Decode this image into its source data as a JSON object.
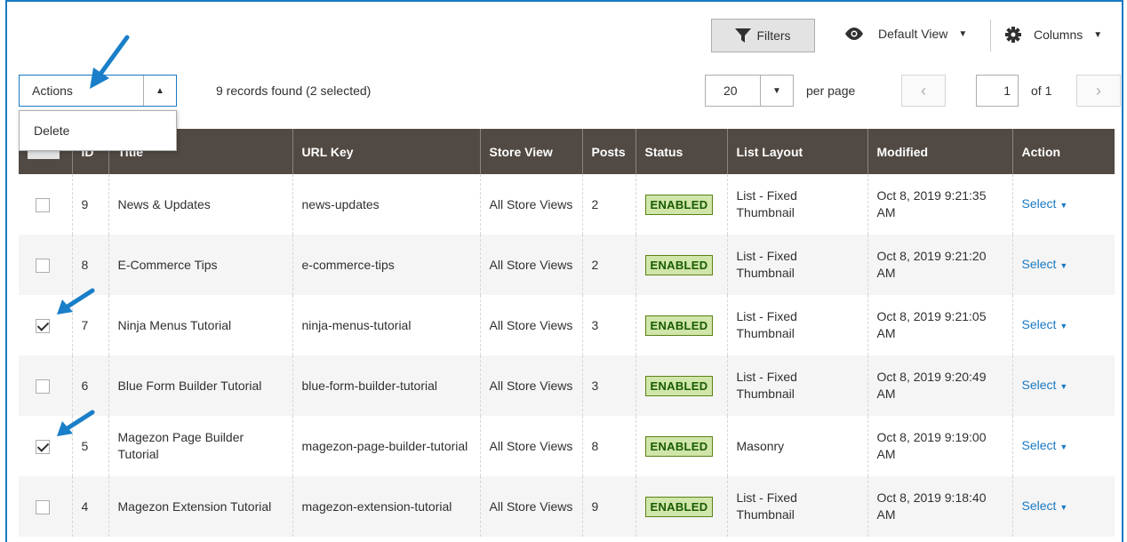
{
  "toolbar": {
    "filters_label": "Filters",
    "view_label": "Default View",
    "columns_label": "Columns"
  },
  "actions": {
    "label": "Actions",
    "menu": [
      "Delete"
    ]
  },
  "records_text": "9 records found (2 selected)",
  "pagination": {
    "per_page_value": "20",
    "per_page_label": "per page",
    "current_page": "1",
    "of_label": "of 1",
    "prev_icon": "chevron-left-icon",
    "next_icon": "chevron-right-icon"
  },
  "table": {
    "headers": [
      "",
      "ID",
      "Title",
      "URL Key",
      "Store View",
      "Posts",
      "Status",
      "List Layout",
      "Modified",
      "Action"
    ],
    "rows": [
      {
        "checked": false,
        "id": "9",
        "title": "News & Updates",
        "url_key": "news-updates",
        "store_view": "All Store Views",
        "posts": "2",
        "status": "ENABLED",
        "layout": "List - Fixed Thumbnail",
        "modified": "Oct 8, 2019 9:21:35 AM",
        "action": "Select"
      },
      {
        "checked": false,
        "id": "8",
        "title": "E-Commerce Tips",
        "url_key": "e-commerce-tips",
        "store_view": "All Store Views",
        "posts": "2",
        "status": "ENABLED",
        "layout": "List - Fixed Thumbnail",
        "modified": "Oct 8, 2019 9:21:20 AM",
        "action": "Select"
      },
      {
        "checked": true,
        "id": "7",
        "title": "Ninja Menus Tutorial",
        "url_key": "ninja-menus-tutorial",
        "store_view": "All Store Views",
        "posts": "3",
        "status": "ENABLED",
        "layout": "List - Fixed Thumbnail",
        "modified": "Oct 8, 2019 9:21:05 AM",
        "action": "Select"
      },
      {
        "checked": false,
        "id": "6",
        "title": "Blue Form Builder Tutorial",
        "url_key": "blue-form-builder-tutorial",
        "store_view": "All Store Views",
        "posts": "3",
        "status": "ENABLED",
        "layout": "List - Fixed Thumbnail",
        "modified": "Oct 8, 2019 9:20:49 AM",
        "action": "Select"
      },
      {
        "checked": true,
        "id": "5",
        "title": "Magezon Page Builder Tutorial",
        "url_key": "magezon-page-builder-tutorial",
        "store_view": "All Store Views",
        "posts": "8",
        "status": "ENABLED",
        "layout": "Masonry",
        "modified": "Oct 8, 2019 9:19:00 AM",
        "action": "Select"
      },
      {
        "checked": false,
        "id": "4",
        "title": "Magezon Extension Tutorial",
        "url_key": "magezon-extension-tutorial",
        "store_view": "All Store Views",
        "posts": "9",
        "status": "ENABLED",
        "layout": "List - Fixed Thumbnail",
        "modified": "Oct 8, 2019 9:18:40 AM",
        "action": "Select"
      }
    ]
  },
  "colors": {
    "header_bg": "#514943",
    "accent": "#1979c3",
    "annotation_arrow": "#1a7fc8"
  }
}
